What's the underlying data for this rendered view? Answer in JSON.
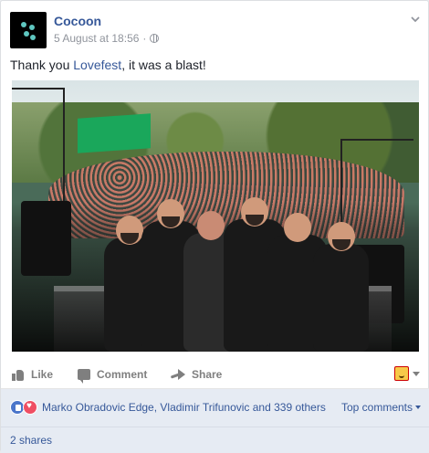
{
  "post": {
    "page_name": "Cocoon",
    "timestamp": "5 August at 18:56",
    "separator": "·",
    "visibility_icon": "globe-icon",
    "options_icon": "chevron-down-icon",
    "message_before": "Thank you ",
    "message_link": "Lovefest",
    "message_after": ", it was a blast!",
    "photo_label": ""
  },
  "actions": {
    "like": "Like",
    "comment": "Comment",
    "share": "Share",
    "reaction_picker_icon": "reaction-picker-icon"
  },
  "summary": {
    "reactors": "Marko Obradovic Edge, Vladimir Trifunovic and 339 others",
    "top_comments": "Top comments",
    "shares": "2 shares"
  },
  "colors": {
    "link": "#365899",
    "muted": "#90949c",
    "summary_background": "#e6ebf3",
    "like_reaction": "#4a75ca",
    "love_reaction": "#ef4e63"
  }
}
